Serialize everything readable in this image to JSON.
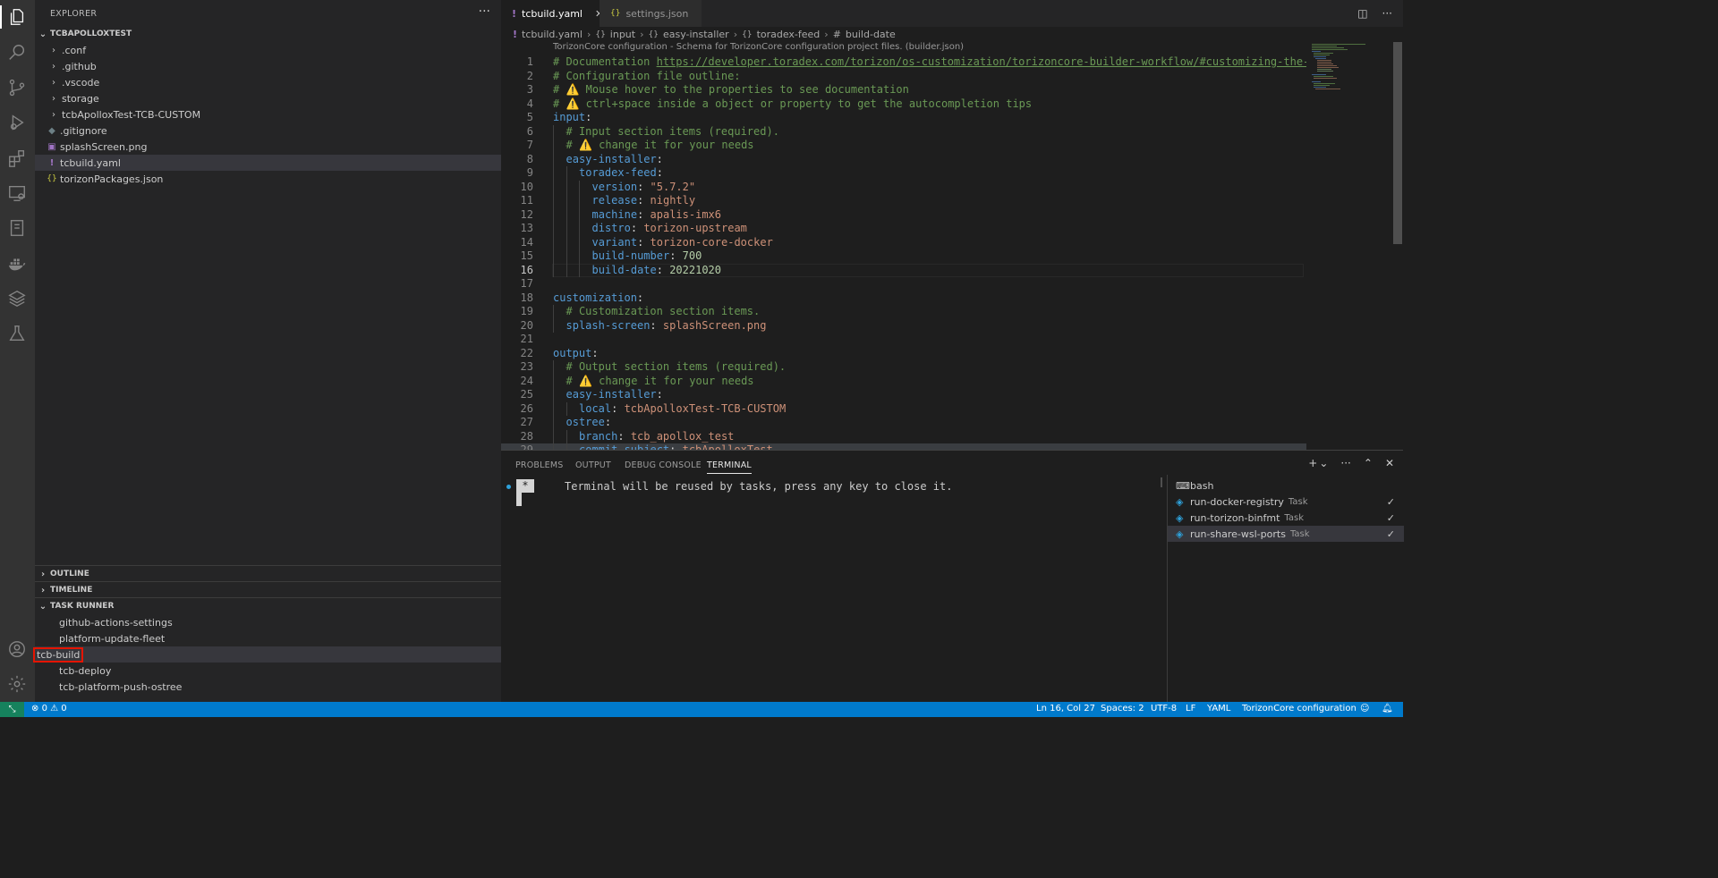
{
  "activity_bar": {
    "icons": [
      "explorer-icon",
      "search-icon",
      "source-control-icon",
      "run-debug-icon",
      "extensions-icon",
      "remote-explorer-icon",
      "notebook-icon",
      "docker-icon",
      "torizon-icon",
      "testing-icon"
    ],
    "bottom_icons": [
      "account-icon",
      "settings-gear-icon"
    ]
  },
  "sidebar": {
    "title": "EXPLORER",
    "more": "···",
    "workspace": "TCBAPOLLOXTEST",
    "items": [
      {
        "label": ".conf",
        "type": "folder"
      },
      {
        "label": ".github",
        "type": "folder"
      },
      {
        "label": ".vscode",
        "type": "folder"
      },
      {
        "label": "storage",
        "type": "folder"
      },
      {
        "label": "tcbApolloxTest-TCB-CUSTOM",
        "type": "folder"
      },
      {
        "label": ".gitignore",
        "type": "file",
        "icon": "◆"
      },
      {
        "label": "splashScreen.png",
        "type": "file",
        "icon": "▣"
      },
      {
        "label": "tcbuild.yaml",
        "type": "file",
        "icon": "!",
        "selected": true
      },
      {
        "label": "torizonPackages.json",
        "type": "file",
        "icon": "{}"
      }
    ],
    "outline": "OUTLINE",
    "timeline": "TIMELINE",
    "task_runner": "TASK RUNNER",
    "tasks": [
      "github-actions-settings",
      "platform-update-fleet",
      "tcb-build",
      "tcb-deploy",
      "tcb-platform-push-ostree"
    ],
    "highlighted_task": "tcb-build"
  },
  "tabs": [
    {
      "label": "tcbuild.yaml",
      "icon": "!",
      "active": true,
      "close": "✕"
    },
    {
      "label": "settings.json",
      "icon": "{}",
      "active": false
    }
  ],
  "breadcrumb": [
    "tcbuild.yaml",
    "input",
    "easy-installer",
    "toradex-feed",
    "build-date"
  ],
  "breadcrumb_icons": [
    "!",
    "{}",
    "{}",
    "{}",
    "#"
  ],
  "schema_hint": "TorizonCore configuration - Schema for TorizonCore configuration project files. (builder.json)",
  "code": {
    "current_line": 16,
    "lines": [
      {
        "n": "1",
        "indent": 0,
        "parts": [
          {
            "t": "# Documentation ",
            "c": "com"
          },
          {
            "t": "https://developer.toradex.com/torizon/os-customization/torizoncore-builder-workflow/#customizing-the-configuration-file",
            "c": "link"
          }
        ]
      },
      {
        "n": "2",
        "indent": 0,
        "parts": [
          {
            "t": "# Configuration file outline:",
            "c": "com"
          }
        ]
      },
      {
        "n": "3",
        "indent": 0,
        "parts": [
          {
            "t": "# ",
            "c": "com"
          },
          {
            "t": "⚠️",
            "c": "warn"
          },
          {
            "t": " Mouse hover to the properties to see documentation",
            "c": "com"
          }
        ]
      },
      {
        "n": "4",
        "indent": 0,
        "parts": [
          {
            "t": "# ",
            "c": "com"
          },
          {
            "t": "⚠️",
            "c": "warn"
          },
          {
            "t": " ctrl+space inside a object or property to get the autocompletion tips",
            "c": "com"
          }
        ]
      },
      {
        "n": "5",
        "indent": 0,
        "parts": [
          {
            "t": "input",
            "c": "key"
          },
          {
            "t": ":",
            "c": "plain"
          }
        ]
      },
      {
        "n": "6",
        "indent": 1,
        "parts": [
          {
            "t": "# Input section items (required).",
            "c": "com"
          }
        ]
      },
      {
        "n": "7",
        "indent": 1,
        "parts": [
          {
            "t": "# ",
            "c": "com"
          },
          {
            "t": "⚠️",
            "c": "warn"
          },
          {
            "t": " change it for your needs",
            "c": "com"
          }
        ]
      },
      {
        "n": "8",
        "indent": 1,
        "parts": [
          {
            "t": "easy-installer",
            "c": "key"
          },
          {
            "t": ":",
            "c": "plain"
          }
        ]
      },
      {
        "n": "9",
        "indent": 2,
        "parts": [
          {
            "t": "toradex-feed",
            "c": "key"
          },
          {
            "t": ":",
            "c": "plain"
          }
        ]
      },
      {
        "n": "10",
        "indent": 3,
        "parts": [
          {
            "t": "version",
            "c": "key"
          },
          {
            "t": ": ",
            "c": "plain"
          },
          {
            "t": "\"5.7.2\"",
            "c": "str"
          }
        ]
      },
      {
        "n": "11",
        "indent": 3,
        "parts": [
          {
            "t": "release",
            "c": "key"
          },
          {
            "t": ": ",
            "c": "plain"
          },
          {
            "t": "nightly",
            "c": "str"
          }
        ]
      },
      {
        "n": "12",
        "indent": 3,
        "parts": [
          {
            "t": "machine",
            "c": "key"
          },
          {
            "t": ": ",
            "c": "plain"
          },
          {
            "t": "apalis-imx6",
            "c": "str"
          }
        ]
      },
      {
        "n": "13",
        "indent": 3,
        "parts": [
          {
            "t": "distro",
            "c": "key"
          },
          {
            "t": ": ",
            "c": "plain"
          },
          {
            "t": "torizon-upstream",
            "c": "str"
          }
        ]
      },
      {
        "n": "14",
        "indent": 3,
        "parts": [
          {
            "t": "variant",
            "c": "key"
          },
          {
            "t": ": ",
            "c": "plain"
          },
          {
            "t": "torizon-core-docker",
            "c": "str"
          }
        ]
      },
      {
        "n": "15",
        "indent": 3,
        "parts": [
          {
            "t": "build-number",
            "c": "key"
          },
          {
            "t": ": ",
            "c": "plain"
          },
          {
            "t": "700",
            "c": "num"
          }
        ]
      },
      {
        "n": "16",
        "indent": 3,
        "parts": [
          {
            "t": "build-date",
            "c": "key"
          },
          {
            "t": ": ",
            "c": "plain"
          },
          {
            "t": "20221020",
            "c": "num"
          }
        ]
      },
      {
        "n": "17",
        "indent": 0,
        "parts": []
      },
      {
        "n": "18",
        "indent": 0,
        "parts": [
          {
            "t": "customization",
            "c": "key"
          },
          {
            "t": ":",
            "c": "plain"
          }
        ]
      },
      {
        "n": "19",
        "indent": 1,
        "parts": [
          {
            "t": "# Customization section items.",
            "c": "com"
          }
        ]
      },
      {
        "n": "20",
        "indent": 1,
        "parts": [
          {
            "t": "splash-screen",
            "c": "key"
          },
          {
            "t": ": ",
            "c": "plain"
          },
          {
            "t": "splashScreen.png",
            "c": "str"
          }
        ]
      },
      {
        "n": "21",
        "indent": 0,
        "parts": []
      },
      {
        "n": "22",
        "indent": 0,
        "parts": [
          {
            "t": "output",
            "c": "key"
          },
          {
            "t": ":",
            "c": "plain"
          }
        ]
      },
      {
        "n": "23",
        "indent": 1,
        "parts": [
          {
            "t": "# Output section items (required).",
            "c": "com"
          }
        ]
      },
      {
        "n": "24",
        "indent": 1,
        "parts": [
          {
            "t": "# ",
            "c": "com"
          },
          {
            "t": "⚠️",
            "c": "warn"
          },
          {
            "t": " change it for your needs",
            "c": "com"
          }
        ]
      },
      {
        "n": "25",
        "indent": 1,
        "parts": [
          {
            "t": "easy-installer",
            "c": "key"
          },
          {
            "t": ":",
            "c": "plain"
          }
        ]
      },
      {
        "n": "26",
        "indent": 2,
        "parts": [
          {
            "t": "local",
            "c": "key"
          },
          {
            "t": ": ",
            "c": "plain"
          },
          {
            "t": "tcbApolloxTest-TCB-CUSTOM",
            "c": "str"
          }
        ]
      },
      {
        "n": "27",
        "indent": 1,
        "parts": [
          {
            "t": "ostree",
            "c": "key"
          },
          {
            "t": ":",
            "c": "plain"
          }
        ]
      },
      {
        "n": "28",
        "indent": 2,
        "parts": [
          {
            "t": "branch",
            "c": "key"
          },
          {
            "t": ": ",
            "c": "plain"
          },
          {
            "t": "tcb_apollox_test",
            "c": "str"
          }
        ]
      },
      {
        "n": "29",
        "indent": 2,
        "parts": [
          {
            "t": "commit-subject",
            "c": "key"
          },
          {
            "t": ": ",
            "c": "plain"
          },
          {
            "t": "tcbApolloxTest",
            "c": "str"
          }
        ]
      }
    ]
  },
  "panel": {
    "tabs": [
      "PROBLEMS",
      "OUTPUT",
      "DEBUG CONSOLE",
      "TERMINAL"
    ],
    "active_tab": "TERMINAL",
    "actions": [
      "+",
      "⌄",
      "···",
      "⌃",
      "✕"
    ],
    "terminal_star": "*",
    "terminal_text": "Terminal will be reused by tasks, press any key to close it.",
    "terminals": [
      {
        "name": "bash",
        "kind": "",
        "check": ""
      },
      {
        "name": "run-docker-registry",
        "kind": "Task",
        "check": "✓"
      },
      {
        "name": "run-torizon-binfmt",
        "kind": "Task",
        "check": "✓"
      },
      {
        "name": "run-share-wsl-ports",
        "kind": "Task",
        "check": "✓",
        "selected": true
      }
    ]
  },
  "statusbar": {
    "remote": "⤡",
    "errors": "0",
    "warnings": "0",
    "position": "Ln 16, Col 27",
    "spaces": "Spaces: 2",
    "encoding": "UTF-8",
    "eol": "LF",
    "language": "YAML",
    "schema": "TorizonCore configuration"
  },
  "colors": {
    "accent": "#007acc",
    "remote": "#16825d",
    "highlight_border": "#e51400"
  }
}
